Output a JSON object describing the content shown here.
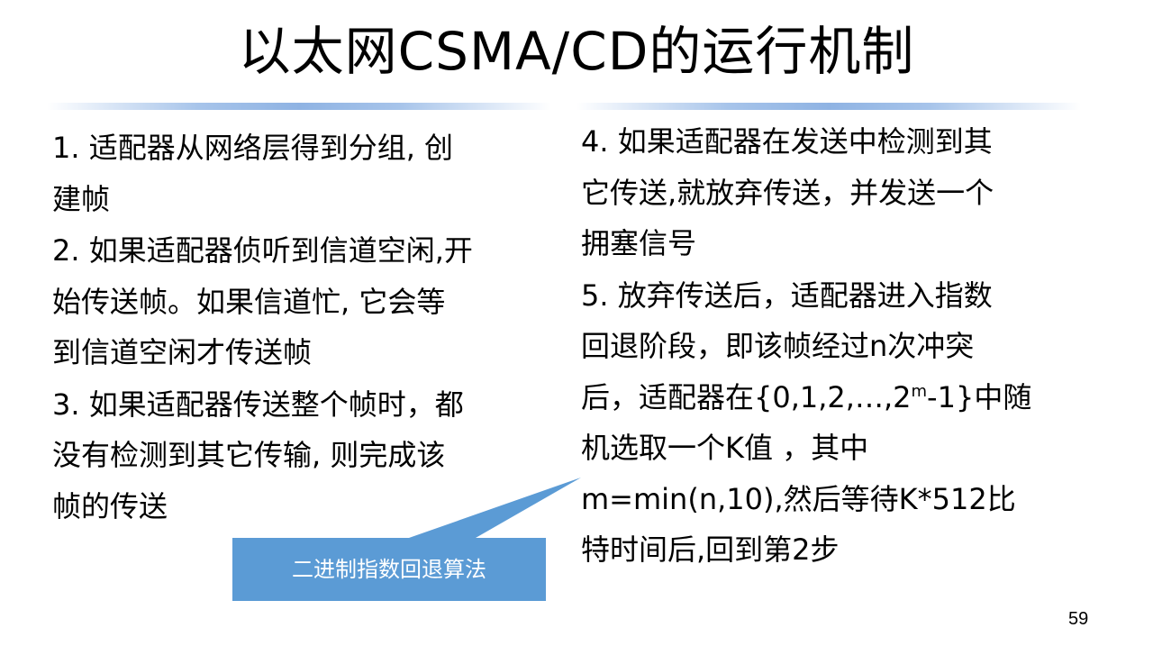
{
  "slide": {
    "title": "以太网CSMA/CD的运行机制",
    "left_items": [
      {
        "lines": [
          "1. 适配器从网络层得到分组, 创",
          "建帧"
        ]
      },
      {
        "lines": [
          "2. 如果适配器侦听到信道空闲,开",
          "始传送帧。如果信道忙, 它会等",
          "到信道空闲才传送帧"
        ]
      },
      {
        "lines": [
          "3. 如果适配器传送整个帧时，都",
          "没有检测到其它传输, 则完成该",
          "帧的传送"
        ]
      }
    ],
    "right_item_4": {
      "lines": [
        "4. 如果适配器在发送中检测到其",
        "它传送,就放弃传送，并发送一个",
        "拥塞信号"
      ]
    },
    "right_item_5": {
      "line1": "5. 放弃传送后，适配器进入指数",
      "line2": "回退阶段，即该帧经过n次冲突",
      "line3_pre": "后，适配器在{0,1,2,…,2",
      "line3_sup": "m",
      "line3_post": "-1}中随",
      "line4": "机选取一个K值 ，其中",
      "line5": "m=min(n,10),然后等待K*512比",
      "line6": "特时间后,回到第2步"
    },
    "callout": {
      "text": "二进制指数回退算法",
      "color": "#5b9bd5"
    },
    "page_number": "59"
  }
}
